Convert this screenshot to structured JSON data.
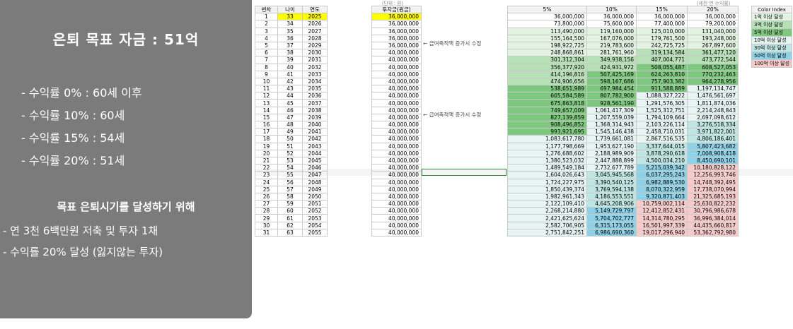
{
  "panel": {
    "title": "은퇴 목표 자금 : 51억",
    "rate_lines": [
      "- 수익률   0% : 60세 이후",
      "- 수익률 10% : 60세",
      "- 수익률 15% : 54세",
      "- 수익률 20% : 51세"
    ],
    "subtitle": "목표 은퇴시기를 달성하기 위해",
    "conditions": [
      "- 연 3천 6백만원 저축 및 투자 1채",
      "- 수익률 20% 달성 (잃지않는 투자)"
    ]
  },
  "sheet": {
    "unit_left": "(단위 : 원)",
    "unit_right": "(세전 연 수익률)",
    "left_headers": [
      "번차",
      "나이",
      "연도"
    ],
    "invest_header": "투자금(원금)",
    "growth_headers": [
      "5%",
      "10%",
      "15%",
      "20%"
    ],
    "note": "← 급여축적액 증가시 수정",
    "legend_header": "Color Index",
    "legend": [
      {
        "label": "1억 이상 달성",
        "color": "#e2f3e2"
      },
      {
        "label": "3억 이상 달성",
        "color": "#b7e0b7"
      },
      {
        "label": "5억 이상 달성",
        "color": "#7fc87f"
      },
      {
        "label": "10억 이상 달성",
        "color": "#e6f4f2"
      },
      {
        "label": "30억 이상 달성",
        "color": "#bfe6e3"
      },
      {
        "label": "50억 이상 달성",
        "color": "#8fd1e6"
      },
      {
        "label": "100억 이상 달성",
        "color": "#f8cbcb"
      }
    ],
    "rows": [
      [
        "1",
        "33",
        "2025",
        "36,000,000",
        "36,000,000",
        "36,000,000",
        "36,000,000",
        "36,000,000"
      ],
      [
        "2",
        "34",
        "2026",
        "36,000,000",
        "73,800,000",
        "75,600,000",
        "77,400,000",
        "79,200,000"
      ],
      [
        "3",
        "35",
        "2027",
        "36,000,000",
        "113,490,000",
        "119,160,000",
        "125,010,000",
        "131,040,000"
      ],
      [
        "4",
        "36",
        "2028",
        "36,000,000",
        "155,164,500",
        "167,076,000",
        "179,761,500",
        "193,248,000"
      ],
      [
        "5",
        "37",
        "2029",
        "36,000,000",
        "198,922,725",
        "219,783,600",
        "242,725,725",
        "267,897,600"
      ],
      [
        "6",
        "38",
        "2030",
        "40,000,000",
        "248,868,861",
        "281,761,960",
        "319,134,584",
        "361,477,120"
      ],
      [
        "7",
        "39",
        "2031",
        "40,000,000",
        "301,312,304",
        "349,938,156",
        "407,004,771",
        "473,772,544"
      ],
      [
        "8",
        "40",
        "2032",
        "40,000,000",
        "356,377,920",
        "424,931,972",
        "508,055,487",
        "608,527,053"
      ],
      [
        "9",
        "41",
        "2033",
        "40,000,000",
        "414,196,816",
        "507,425,169",
        "624,263,810",
        "770,232,463"
      ],
      [
        "10",
        "42",
        "2034",
        "40,000,000",
        "474,906,656",
        "598,167,686",
        "757,903,382",
        "964,278,956"
      ],
      [
        "11",
        "43",
        "2035",
        "40,000,000",
        "538,651,989",
        "697,984,454",
        "911,588,889",
        "1,197,134,747"
      ],
      [
        "12",
        "44",
        "2036",
        "40,000,000",
        "605,584,589",
        "807,782,900",
        "1,088,327,222",
        "1,476,561,697"
      ],
      [
        "13",
        "45",
        "2037",
        "40,000,000",
        "675,863,818",
        "928,561,190",
        "1,291,576,305",
        "1,811,874,036"
      ],
      [
        "14",
        "46",
        "2038",
        "40,000,000",
        "749,657,009",
        "1,061,417,309",
        "1,525,312,751",
        "2,214,248,843"
      ],
      [
        "15",
        "47",
        "2039",
        "40,000,000",
        "827,139,859",
        "1,207,559,039",
        "1,794,109,664",
        "2,697,098,612"
      ],
      [
        "16",
        "48",
        "2040",
        "40,000,000",
        "908,496,852",
        "1,368,314,943",
        "2,103,226,114",
        "3,276,518,334"
      ],
      [
        "17",
        "49",
        "2041",
        "40,000,000",
        "993,921,695",
        "1,545,146,438",
        "2,458,710,031",
        "3,971,822,001"
      ],
      [
        "18",
        "50",
        "2042",
        "40,000,000",
        "1,083,617,780",
        "1,739,661,081",
        "2,867,516,535",
        "4,806,186,401"
      ],
      [
        "19",
        "51",
        "2043",
        "40,000,000",
        "1,177,798,669",
        "1,953,627,190",
        "3,337,644,015",
        "5,807,423,682"
      ],
      [
        "20",
        "52",
        "2044",
        "40,000,000",
        "1,276,688,602",
        "2,188,989,909",
        "3,878,290,618",
        "7,008,908,418"
      ],
      [
        "21",
        "53",
        "2045",
        "40,000,000",
        "1,380,523,032",
        "2,447,888,899",
        "4,500,034,210",
        "8,450,690,101"
      ],
      [
        "22",
        "54",
        "2046",
        "40,000,000",
        "1,489,549,184",
        "2,732,677,789",
        "5,215,039,342",
        "10,180,828,122"
      ],
      [
        "23",
        "55",
        "2047",
        "40,000,000",
        "1,604,026,643",
        "3,045,945,568",
        "6,037,295,243",
        "12,256,993,746"
      ],
      [
        "24",
        "56",
        "2048",
        "40,000,000",
        "1,724,227,975",
        "3,390,540,125",
        "6,982,889,530",
        "14,748,392,495"
      ],
      [
        "25",
        "57",
        "2049",
        "40,000,000",
        "1,850,439,374",
        "3,769,594,138",
        "8,070,322,959",
        "17,738,070,994"
      ],
      [
        "26",
        "58",
        "2050",
        "40,000,000",
        "1,982,961,343",
        "4,186,553,551",
        "9,320,871,403",
        "21,325,685,193"
      ],
      [
        "27",
        "59",
        "2051",
        "40,000,000",
        "2,122,109,410",
        "4,645,208,906",
        "10,759,002,114",
        "25,630,822,232"
      ],
      [
        "28",
        "60",
        "2052",
        "40,000,000",
        "2,268,214,880",
        "5,149,729,797",
        "12,412,852,431",
        "30,796,986,678"
      ],
      [
        "29",
        "61",
        "2053",
        "40,000,000",
        "2,421,625,624",
        "5,704,702,777",
        "14,314,780,295",
        "36,996,384,014"
      ],
      [
        "30",
        "62",
        "2054",
        "40,000,000",
        "2,582,706,905",
        "6,315,173,055",
        "16,501,997,339",
        "44,435,660,817"
      ],
      [
        "31",
        "63",
        "2055",
        "40,000,000",
        "2,751,842,251",
        "6,986,690,360",
        "19,017,296,940",
        "53,362,792,980"
      ]
    ]
  }
}
